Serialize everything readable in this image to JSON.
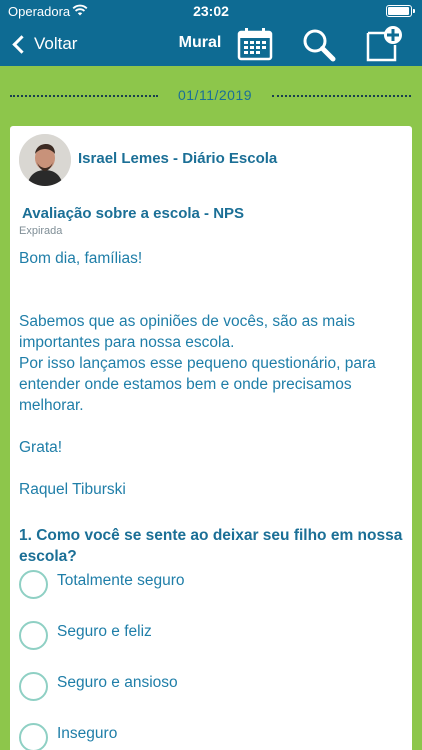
{
  "status_bar": {
    "carrier": "Operadora",
    "time": "23:02"
  },
  "nav": {
    "back_label": "Voltar",
    "title": "Mural"
  },
  "feed": {
    "date": "01/11/2019"
  },
  "post": {
    "author": "Israel Lemes - Diário Escola",
    "title": "Avaliação sobre a escola - NPS",
    "status": "Expirada",
    "body": [
      "Bom dia, famílias!",
      "",
      "",
      "Sabemos que as opiniões de vocês, são as mais",
      "importantes para nossa escola.",
      "Por isso lançamos esse pequeno questionário, para",
      "entender onde estamos bem e onde precisamos",
      "melhorar.",
      "",
      "Grata!",
      "",
      "Raquel Tiburski"
    ],
    "question": "1. Como você se sente ao deixar seu filho em nossa escola?",
    "options": [
      "Totalmente seguro",
      "Seguro e feliz",
      "Seguro e ansioso",
      "Inseguro"
    ]
  },
  "colors": {
    "nav_bg": "#0e6b93",
    "page_bg": "#8dc64b",
    "text_blue": "#1f7ea8",
    "radio_border": "#8fd0c4"
  }
}
